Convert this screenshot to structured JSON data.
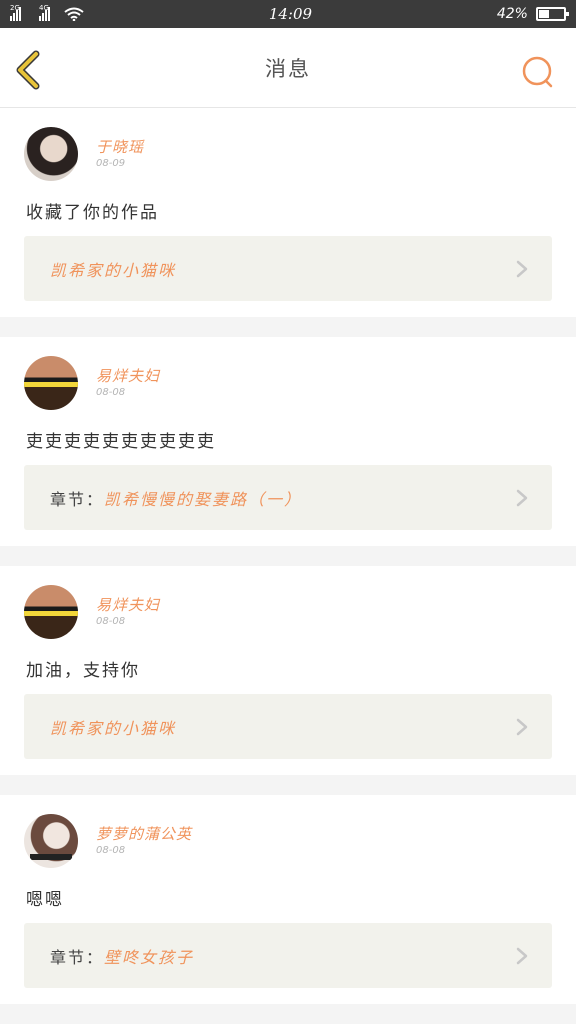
{
  "status_bar": {
    "net_label_1": "2G",
    "net_label_2": "4G",
    "time": "14:09",
    "battery_text": "42%",
    "battery_level": 0.42
  },
  "navbar": {
    "title": "消息"
  },
  "messages": [
    {
      "user": "于晓瑶",
      "date": "08-09",
      "content": "收藏了你的作品",
      "ref_prefix": "",
      "ref_title": "凯希家的小猫咪"
    },
    {
      "user": "易烊夫妇",
      "date": "08-08",
      "content": "吏吏吏吏吏吏吏吏吏吏",
      "ref_prefix": "章节：",
      "ref_title": "凯希慢慢的娶妻路（一）"
    },
    {
      "user": "易烊夫妇",
      "date": "08-08",
      "content": "加油，支持你",
      "ref_prefix": "",
      "ref_title": "凯希家的小猫咪"
    },
    {
      "user": "萝萝的蒲公英",
      "date": "08-08",
      "content": "嗯嗯",
      "ref_prefix": "章节：",
      "ref_title": "壁咚女孩子"
    }
  ],
  "colors": {
    "accent": "#f0935b",
    "back_icon": "#e8c43a",
    "ref_bg": "#f2f2ec"
  }
}
